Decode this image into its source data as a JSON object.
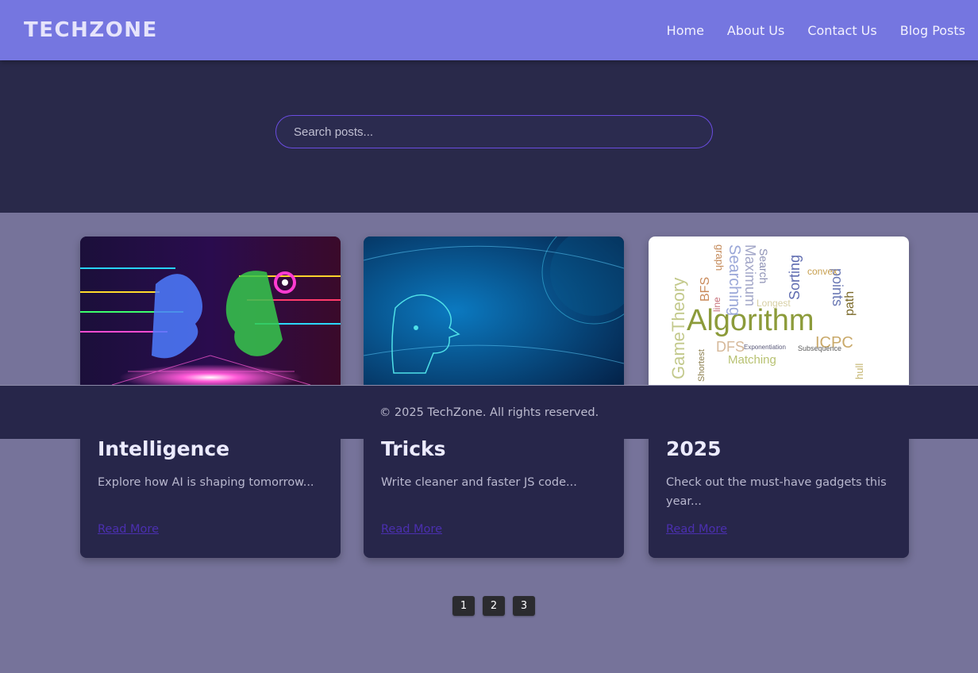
{
  "header": {
    "logo": "TECHZONE",
    "nav": [
      "Home",
      "About Us",
      "Contact Us",
      "Blog Posts"
    ]
  },
  "search": {
    "placeholder": "Search posts..."
  },
  "posts": [
    {
      "title": "Intelligence",
      "excerpt": "Explore how AI is shaping tomorrow...",
      "link": "Read More",
      "image": "ai-faces-image"
    },
    {
      "title": "Tricks",
      "excerpt": "Write cleaner and faster JS code...",
      "link": "Read More",
      "image": "blue-digital-head-image"
    },
    {
      "title": "2025",
      "excerpt": "Check out the must-have gadgets this year...",
      "link": "Read More",
      "image": "algorithm-word-cloud-image",
      "wordcloud": [
        "Algorithm",
        "GameTheory",
        "Searching",
        "Maximum",
        "Sorting",
        "points",
        "BFS",
        "DFS",
        "ICPC",
        "Matching",
        "path",
        "convex",
        "Longest",
        "Subsequence",
        "Shortest",
        "Exponentiation",
        "hull",
        "Search",
        "graph",
        "line"
      ]
    }
  ],
  "footer": {
    "text": "© 2025 TechZone. All rights reserved."
  },
  "pagination": [
    "1",
    "2",
    "3"
  ],
  "colors": {
    "header": "#7576e0",
    "hero": "#29294a",
    "body": "#76739a",
    "card": "#27264a",
    "link": "#4b2fb0"
  }
}
